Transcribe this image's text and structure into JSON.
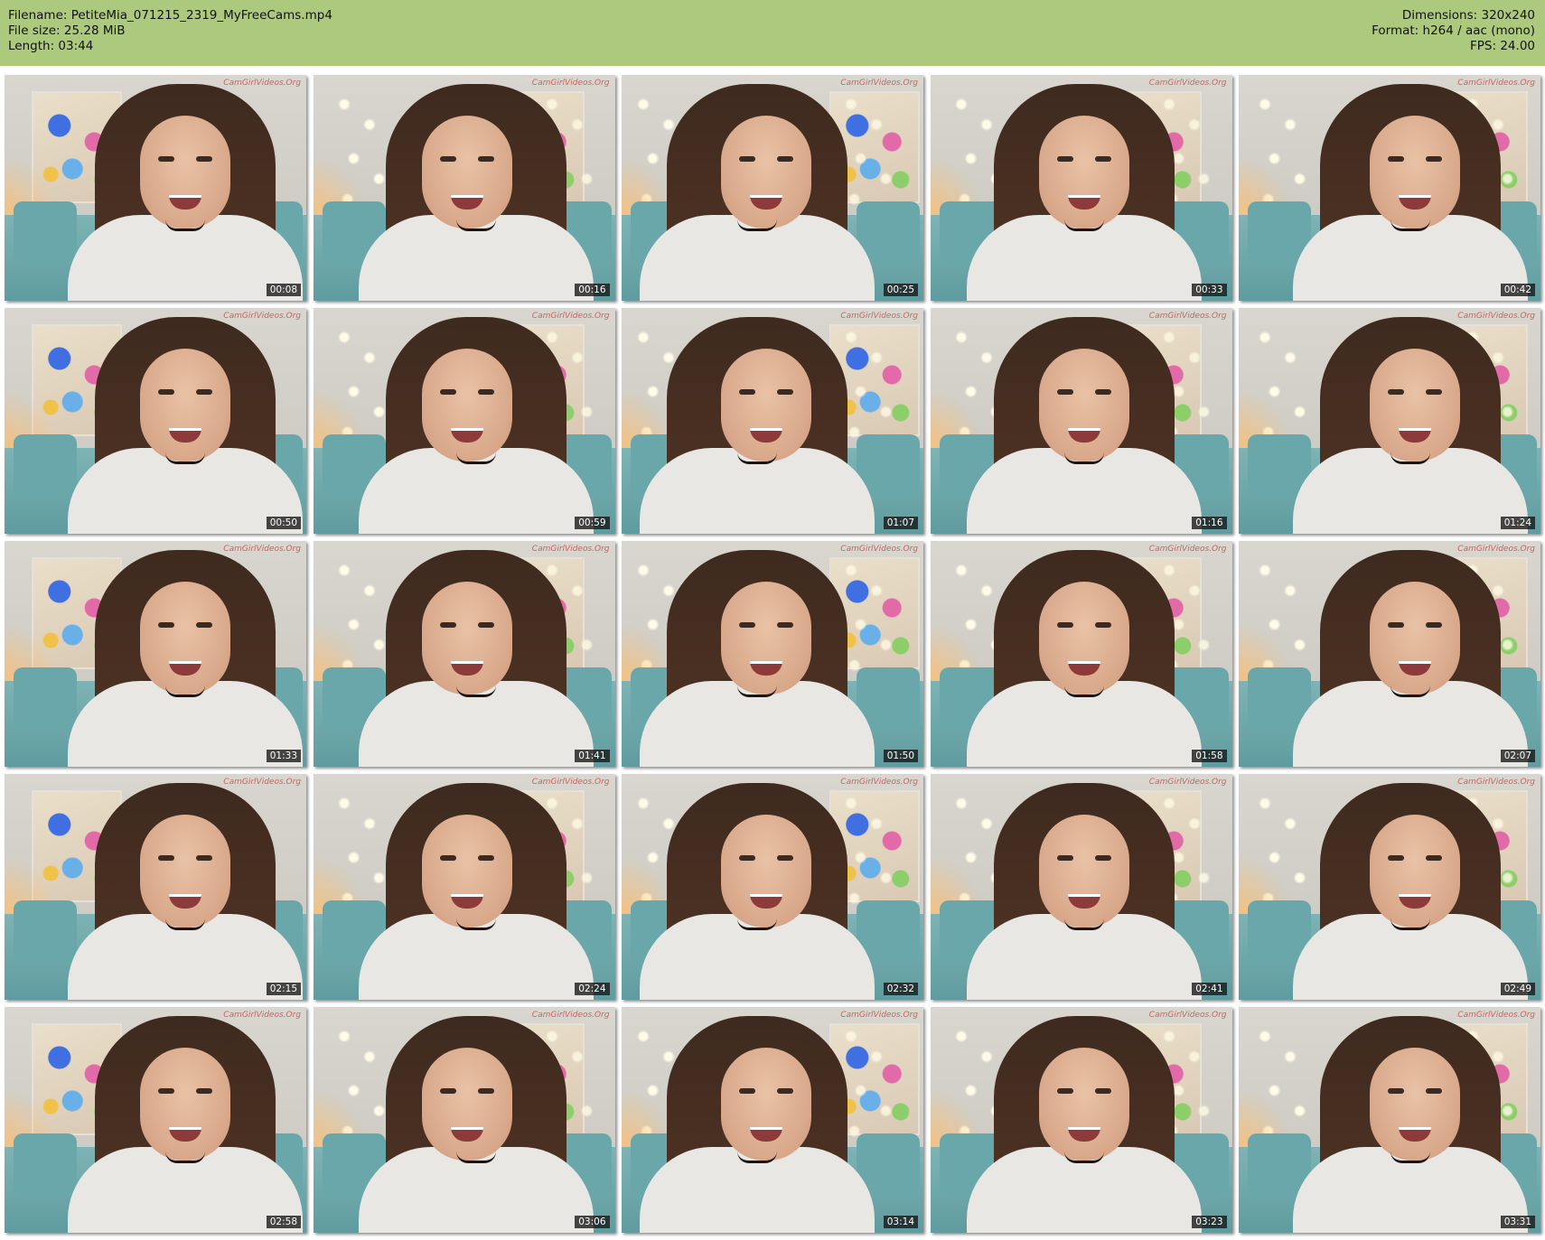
{
  "header": {
    "filename_line": "Filename: PetiteMia_071215_2319_MyFreeCams.mp4",
    "filesize_line": "File size: 25.28 MiB",
    "length_line": "Length: 03:44",
    "dimensions_line": "Dimensions: 320x240",
    "format_line": "Format: h264 / aac (mono)",
    "fps_line": "FPS: 24.00",
    "background_color": "#adc97d"
  },
  "watermark": "CamGirlVideos.Org",
  "thumbnails": [
    {
      "timestamp": "00:08"
    },
    {
      "timestamp": "00:16"
    },
    {
      "timestamp": "00:25"
    },
    {
      "timestamp": "00:33"
    },
    {
      "timestamp": "00:42"
    },
    {
      "timestamp": "00:50"
    },
    {
      "timestamp": "00:59"
    },
    {
      "timestamp": "01:07"
    },
    {
      "timestamp": "01:16"
    },
    {
      "timestamp": "01:24"
    },
    {
      "timestamp": "01:33"
    },
    {
      "timestamp": "01:41"
    },
    {
      "timestamp": "01:50"
    },
    {
      "timestamp": "01:58"
    },
    {
      "timestamp": "02:07"
    },
    {
      "timestamp": "02:15"
    },
    {
      "timestamp": "02:24"
    },
    {
      "timestamp": "02:32"
    },
    {
      "timestamp": "02:41"
    },
    {
      "timestamp": "02:49"
    },
    {
      "timestamp": "02:58"
    },
    {
      "timestamp": "03:06"
    },
    {
      "timestamp": "03:14"
    },
    {
      "timestamp": "03:23"
    },
    {
      "timestamp": "03:31"
    }
  ]
}
